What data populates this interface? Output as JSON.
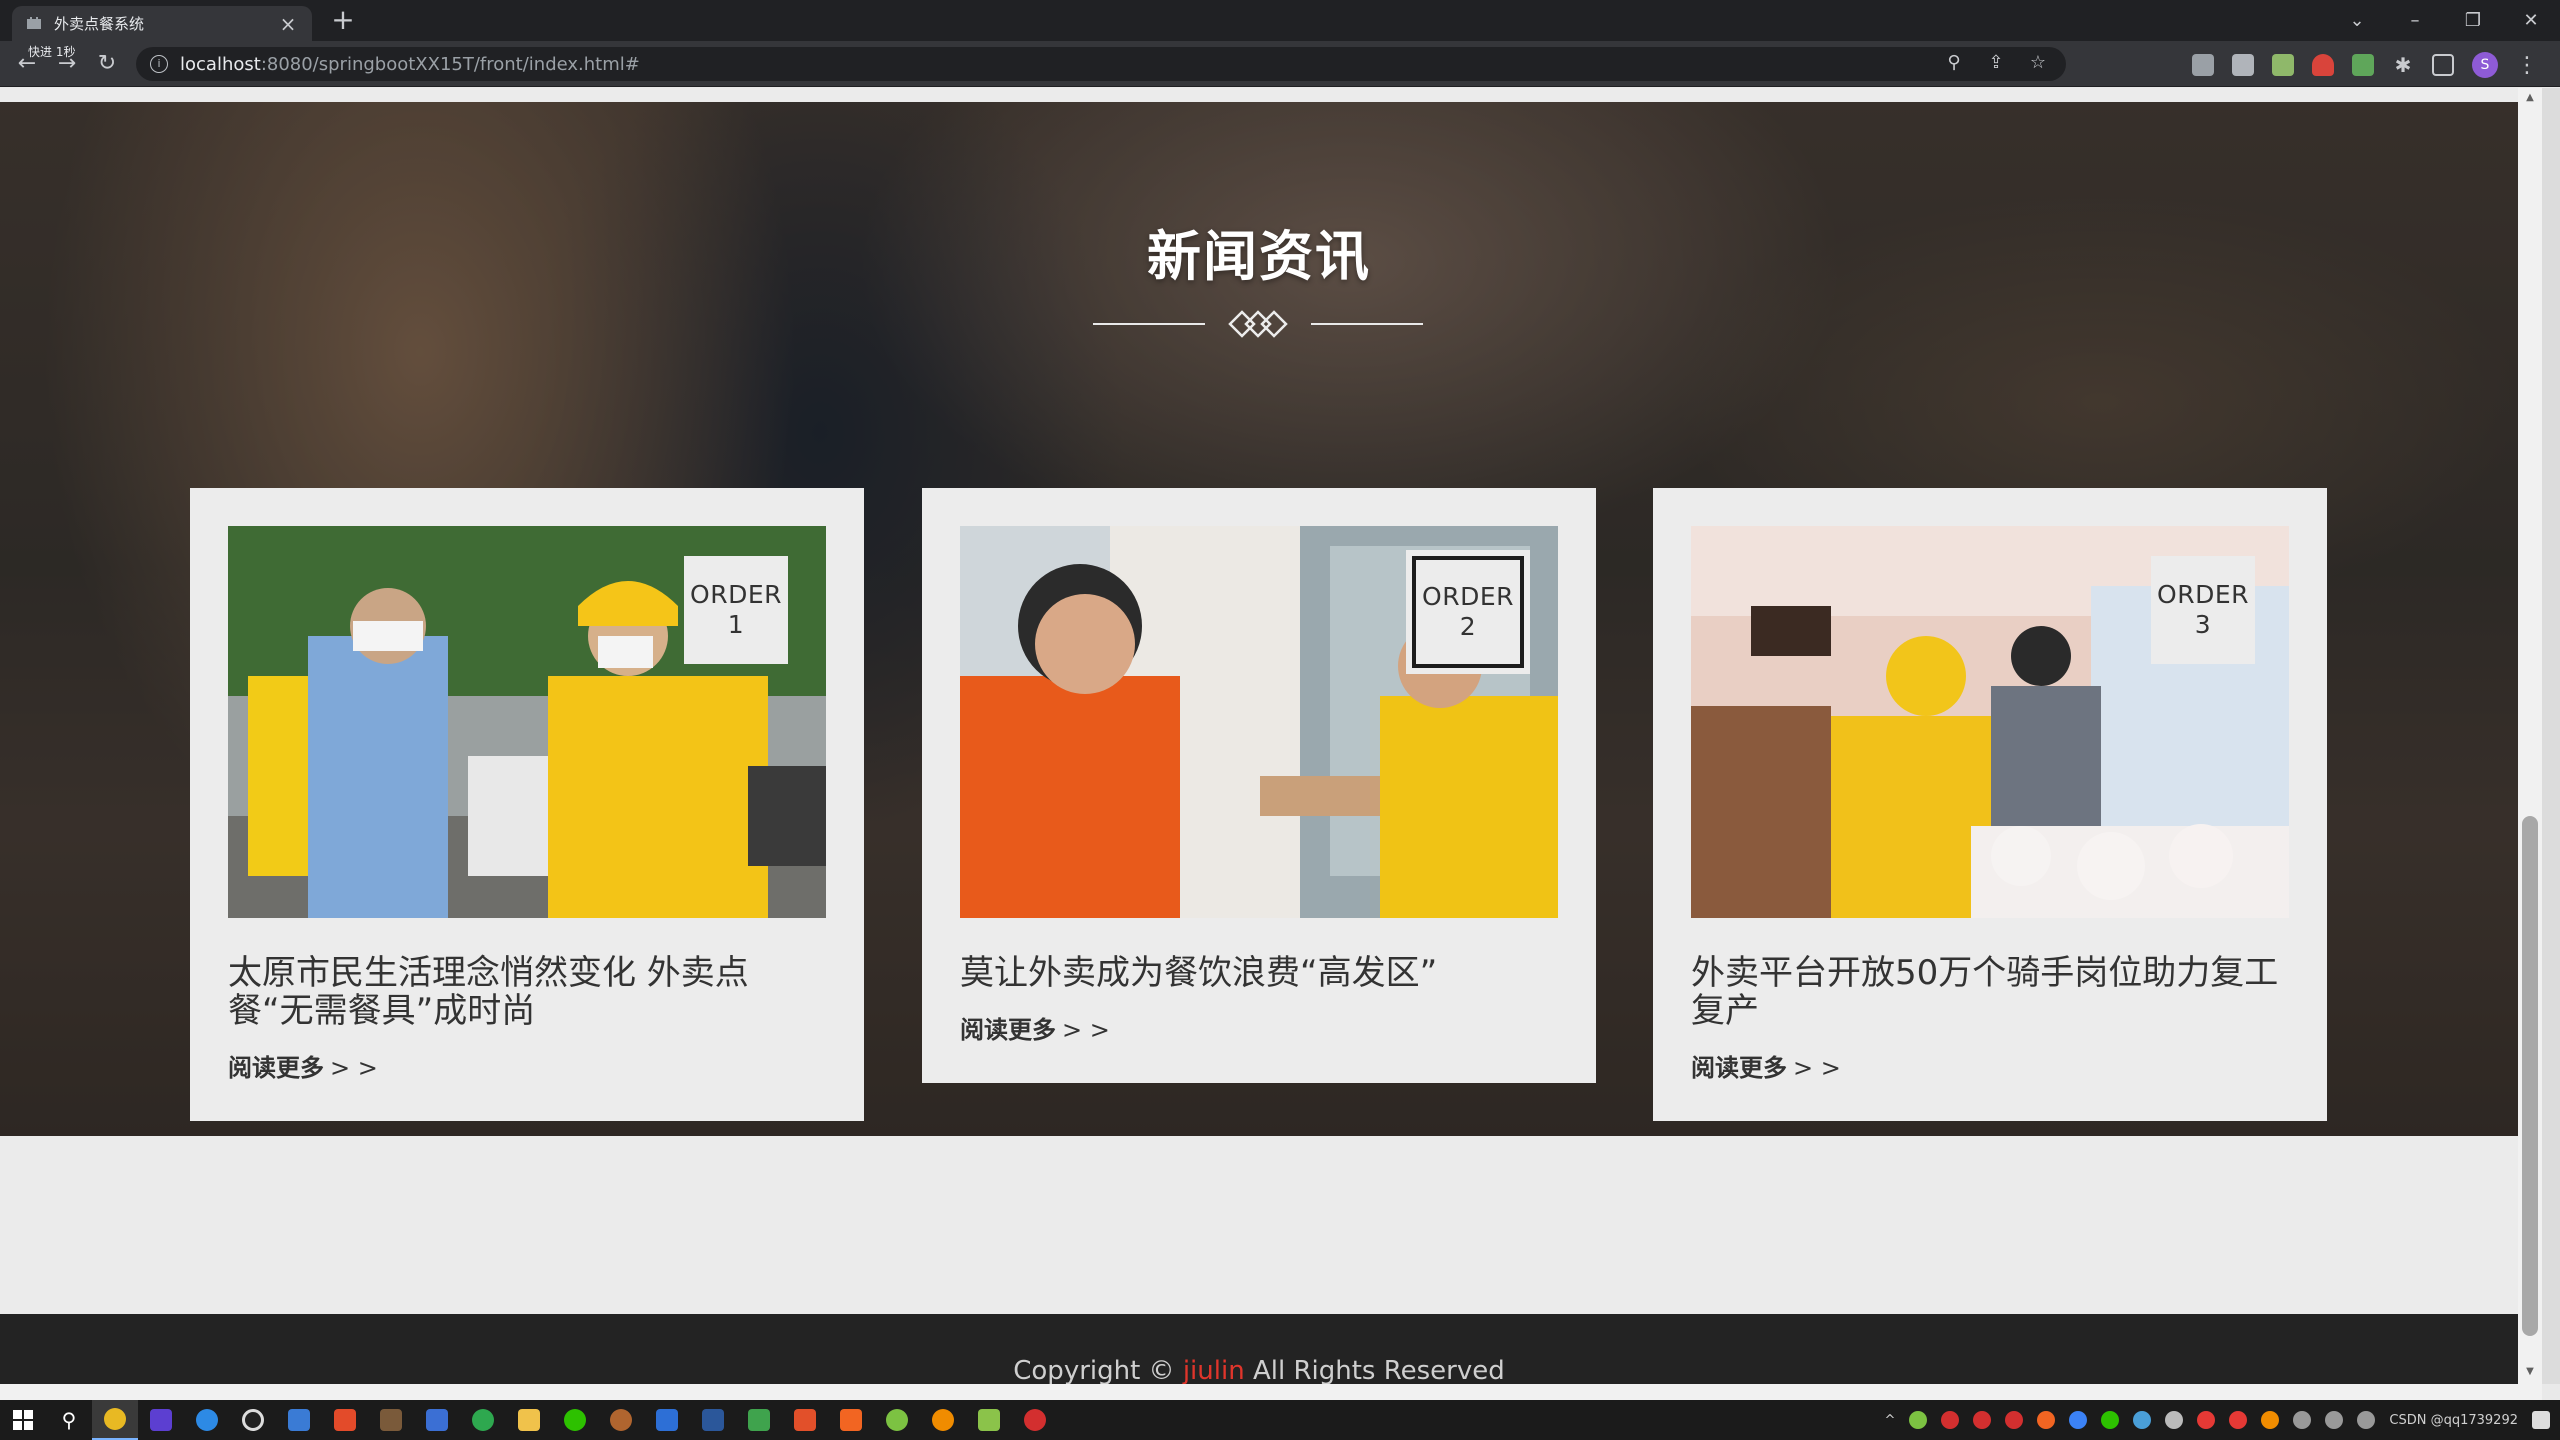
{
  "browser": {
    "tab_title": "外卖点餐系统",
    "tab_close": "×",
    "new_tab": "+",
    "nav_tooltip": "快进 1秒",
    "url_host": "localhost",
    "url_rest": ":8080/springbootXX15T/front/index.html#",
    "profile_initial": "S"
  },
  "news": {
    "title": "新闻资讯",
    "read_more_label": "阅读更多",
    "read_more_arrows": "> >",
    "cards": [
      {
        "order_label": "ORDER",
        "order_number": "1",
        "title": "太原市民生活理念悄然变化 外卖点餐“无需餐具”成时尚"
      },
      {
        "order_label": "ORDER",
        "order_number": "2",
        "title": "莫让外卖成为餐饮浪费“高发区”"
      },
      {
        "order_label": "ORDER",
        "order_number": "3",
        "title": "外卖平台开放50万个骑手岗位助力复工复产"
      }
    ]
  },
  "footer": {
    "prefix": "Copyright © ",
    "link": "jiulin",
    "suffix": " All Rights Reserved"
  },
  "taskbar": {
    "tray_text": "CSDN @qq1739292"
  },
  "colors": {
    "accent_red": "#e0352b",
    "meituan_yellow": "#f6c90e",
    "card_bg": "#ececec"
  }
}
